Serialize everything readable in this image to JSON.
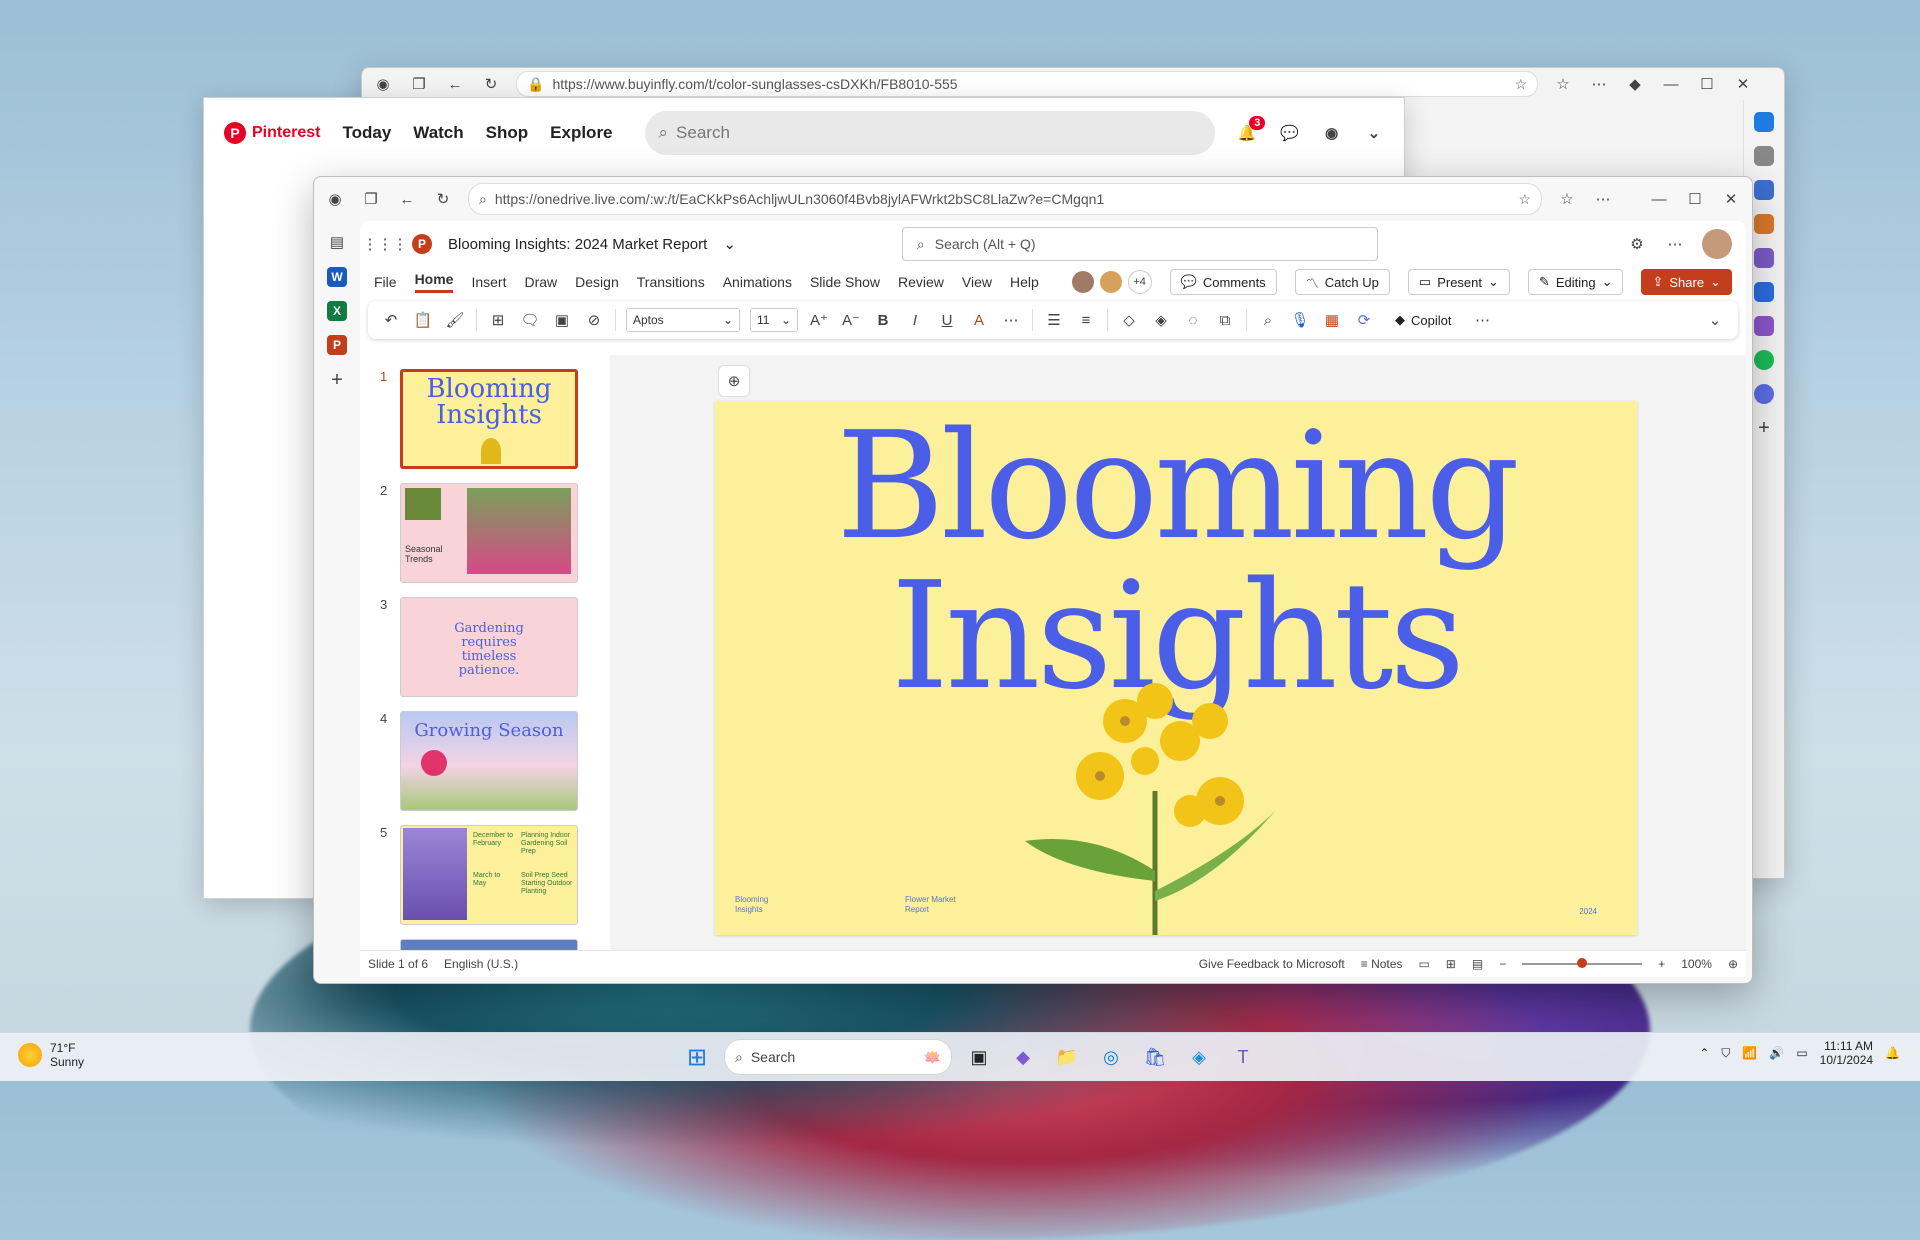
{
  "edge_back": {
    "url": "https://www.buyinfly.com/t/color-sunglasses-csDXKh/FB8010-555"
  },
  "pinterest": {
    "logo": "Pinterest",
    "nav": [
      "Today",
      "Watch",
      "Shop",
      "Explore"
    ],
    "search_placeholder": "Search",
    "notification_count": "3"
  },
  "edge_main": {
    "url": "https://onedrive.live.com/:w:/t/EaCKkPs6AchljwULn3060f4Bvb8jylAFWrkt2bSC8LlaZw?e=CMgqn1"
  },
  "ppt": {
    "doc_title": "Blooming Insights: 2024 Market Report",
    "search_placeholder": "Search (Alt + Q)",
    "menu": [
      "File",
      "Home",
      "Insert",
      "Draw",
      "Design",
      "Transitions",
      "Animations",
      "Slide Show",
      "Review",
      "View",
      "Help"
    ],
    "active_menu": "Home",
    "collab_more": "+4",
    "buttons": {
      "comments": "Comments",
      "catch_up": "Catch Up",
      "present": "Present",
      "editing": "Editing",
      "share": "Share"
    },
    "font_name": "Aptos",
    "font_size": "11",
    "copilot": "Copilot"
  },
  "thumbnails": [
    {
      "num": "1",
      "title": "Blooming Insights"
    },
    {
      "num": "2",
      "title": "Seasonal Trends"
    },
    {
      "num": "3",
      "title": "Gardening requires timeless patience."
    },
    {
      "num": "4",
      "title": "Growing Season"
    },
    {
      "num": "5",
      "col1": "December to February",
      "col1b": "March to May",
      "col2": "Planning Indoor Gardening Soil Prep",
      "col2b": "Soil Prep Seed Starting Outdoor Planting"
    }
  ],
  "slide": {
    "title_line1": "Blooming",
    "title_line2": "Insights",
    "foot_left": "Blooming Insights",
    "foot_mid": "Flower Market Report",
    "foot_right": "2024"
  },
  "status": {
    "slide_of": "Slide 1 of 6",
    "language": "English (U.S.)",
    "feedback": "Give Feedback to Microsoft",
    "notes": "Notes",
    "zoom": "100%",
    "zoom_level": 0.5
  },
  "taskbar": {
    "temp": "71°F",
    "condition": "Sunny",
    "search": "Search",
    "time": "11:11 AM",
    "date": "10/1/2024"
  }
}
